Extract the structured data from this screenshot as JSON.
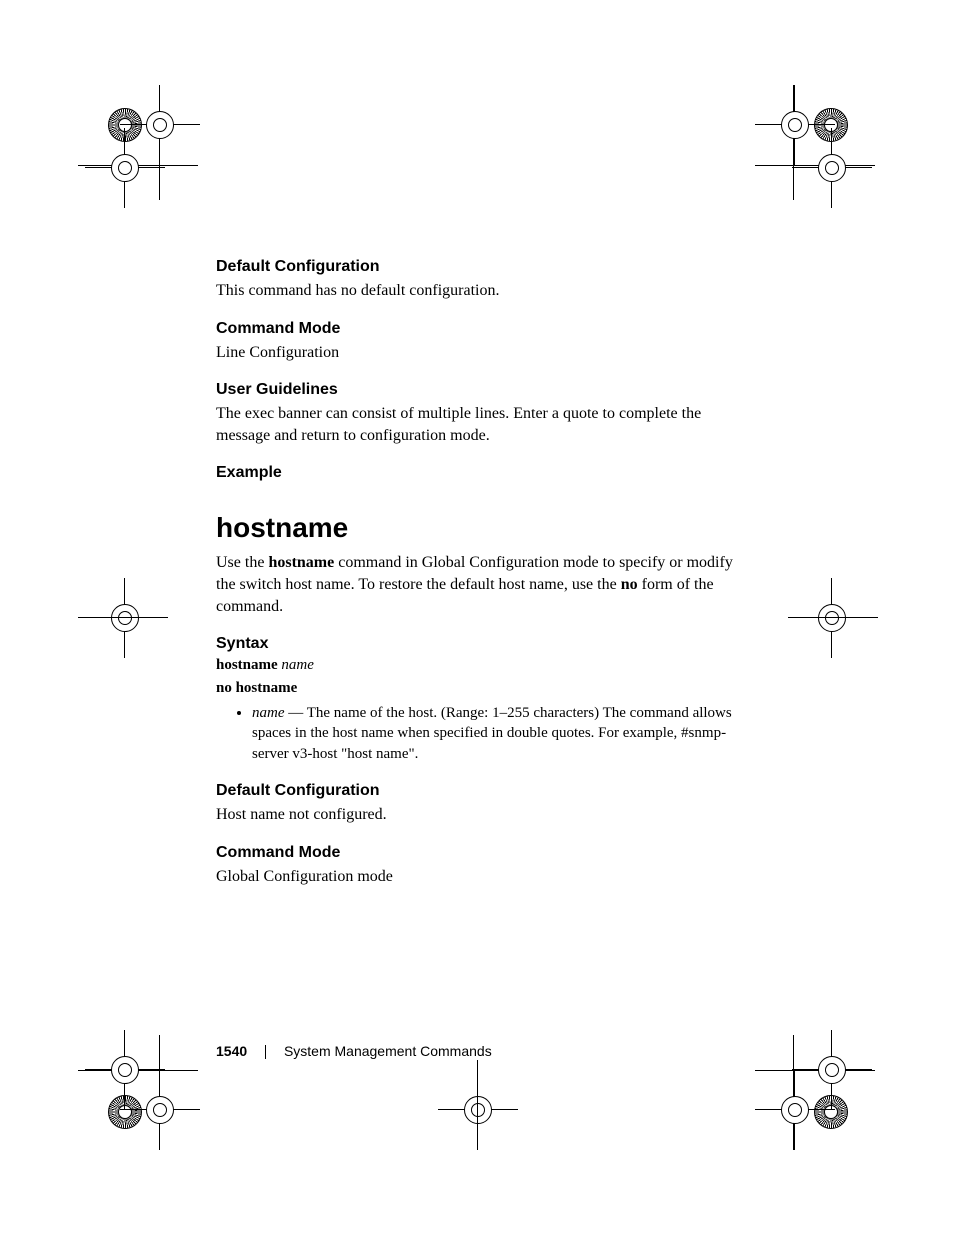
{
  "sections": {
    "defaultConfig1": {
      "heading": "Default Configuration",
      "body": "This command has no default configuration."
    },
    "commandMode1": {
      "heading": "Command Mode",
      "body": "Line Configuration"
    },
    "userGuidelines": {
      "heading": "User Guidelines",
      "body": "The exec banner can consist of multiple lines. Enter a quote to complete the message and return to configuration mode."
    },
    "example": {
      "heading": "Example"
    },
    "commandTitle": "hostname",
    "commandIntro_pre": "Use the ",
    "commandIntro_bold1": "hostname",
    "commandIntro_mid": " command in Global Configuration mode to specify or modify the switch host name. To restore the default host name, use the ",
    "commandIntro_bold2": "no",
    "commandIntro_post": " form of the command.",
    "syntax": {
      "heading": "Syntax",
      "line1_bold": "hostname",
      "line1_italic": "name",
      "line2": "no hostname",
      "bullet_italic": "name",
      "bullet_rest": " — The name of the host. (Range: 1–255 characters) The command allows spaces in the host name when specified in double quotes.  For example,  #snmp-server v3-host \"host name\"."
    },
    "defaultConfig2": {
      "heading": "Default Configuration",
      "body": "Host name not configured."
    },
    "commandMode2": {
      "heading": "Command Mode",
      "body": "Global Configuration mode"
    }
  },
  "footer": {
    "page": "1540",
    "chapter": "System Management Commands"
  }
}
